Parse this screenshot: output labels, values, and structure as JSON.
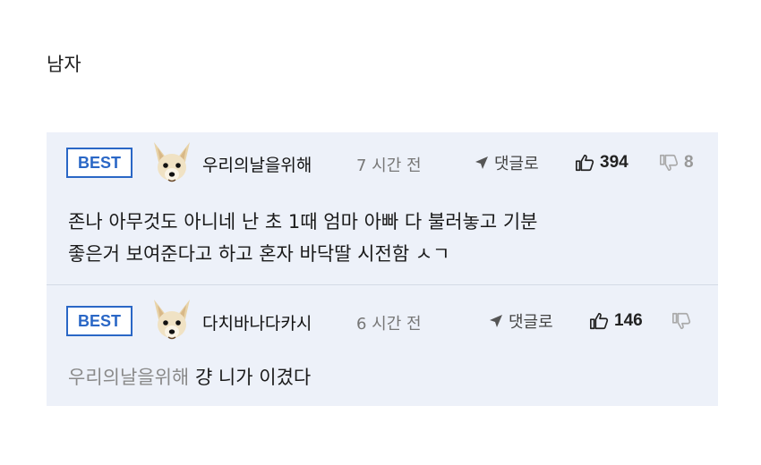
{
  "page": {
    "title": "남자"
  },
  "comments": [
    {
      "badge": "BEST",
      "username": "우리의날을위해",
      "time": "7 시간 전",
      "reply_label": "댓글로",
      "likes": "394",
      "dislikes": "8",
      "lines": [
        "존나 아무것도 아니네 난 초 1때 엄마 아빠 다 불러놓고 기분",
        "좋은거 보여준다고 하고 혼자 바닥딸 시전함 ㅅㄱ"
      ]
    },
    {
      "badge": "BEST",
      "username": "다치바나다카시",
      "time": "6 시간 전",
      "reply_label": "댓글로",
      "likes": "146",
      "mention": "우리의날을위해",
      "text": "걍 니가 이겼다"
    }
  ],
  "colors": {
    "badge_blue": "#2a67c6",
    "panel_bg": "#edf1f9",
    "mention_gray": "#8a8a8a"
  },
  "icons": [
    "dog-avatar",
    "reply-arrow-icon",
    "thumbs-up-icon",
    "thumbs-down-icon"
  ]
}
